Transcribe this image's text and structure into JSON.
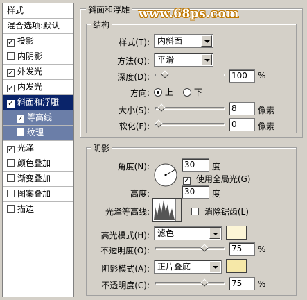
{
  "styles_list": {
    "header": "样式",
    "blend_options": "混合选项:默认",
    "items": [
      {
        "label": "投影",
        "checked": true
      },
      {
        "label": "内阴影",
        "checked": false
      },
      {
        "label": "外发光",
        "checked": true
      },
      {
        "label": "内发光",
        "checked": true
      },
      {
        "label": "斜面和浮雕",
        "checked": true
      },
      {
        "label": "等高线",
        "checked": true
      },
      {
        "label": "纹理",
        "checked": false
      },
      {
        "label": "光泽",
        "checked": true
      },
      {
        "label": "颜色叠加",
        "checked": false
      },
      {
        "label": "渐变叠加",
        "checked": false
      },
      {
        "label": "图案叠加",
        "checked": false
      },
      {
        "label": "描边",
        "checked": false
      }
    ]
  },
  "bevel": {
    "title": "斜面和浮雕",
    "structure_title": "结构",
    "style_label": "样式(T):",
    "style_value": "内斜面",
    "technique_label": "方法(Q):",
    "technique_value": "平滑",
    "depth_label": "深度(D):",
    "depth_value": "100",
    "depth_unit": "%",
    "depth_fraction": 0.1,
    "direction_label": "方向:",
    "direction_up": "上",
    "direction_down": "下",
    "size_label": "大小(S):",
    "size_value": "8",
    "size_unit": "像素",
    "size_fraction": 0.05,
    "soften_label": "软化(F):",
    "soften_value": "0",
    "soften_unit": "像素",
    "soften_fraction": 0.0
  },
  "shading": {
    "title": "阴影",
    "angle_label": "角度(N):",
    "angle_value": "30",
    "angle_unit": "度",
    "global_light_label": "使用全局光(G)",
    "global_light_checked": true,
    "altitude_label": "高度:",
    "altitude_value": "30",
    "altitude_unit": "度",
    "gloss_contour_label": "光泽等高线:",
    "anti_aliased_label": "消除锯齿(L)",
    "anti_aliased_checked": false,
    "highlight_mode_label": "高光模式(H):",
    "highlight_mode_value": "滤色",
    "highlight_color": "#fcf5d6",
    "highlight_opacity_label": "不透明度(O):",
    "highlight_opacity_value": "75",
    "highlight_opacity_unit": "%",
    "highlight_opacity_fraction": 0.75,
    "shadow_mode_label": "阴影模式(A):",
    "shadow_mode_value": "正片叠底",
    "shadow_color": "#f6e8a8",
    "shadow_opacity_label": "不透明度(C):",
    "shadow_opacity_value": "75",
    "shadow_opacity_unit": "%",
    "shadow_opacity_fraction": 0.75
  },
  "watermark": "www.68ps.com"
}
